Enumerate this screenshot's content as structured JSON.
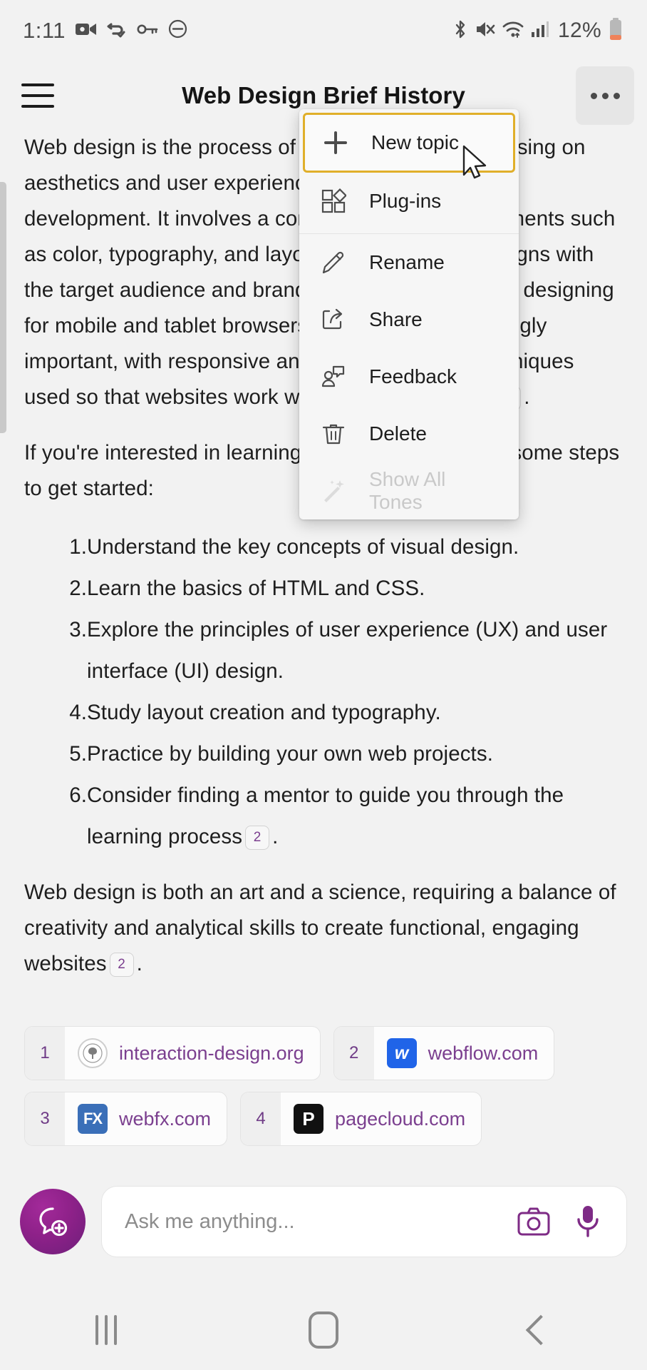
{
  "status_bar": {
    "time": "1:11",
    "battery_percent": "12%",
    "left_icons": [
      "camcorder-icon",
      "vpn-key-sync-icon",
      "key-icon",
      "dnd-icon"
    ],
    "right_icons": [
      "bluetooth-icon",
      "mute-icon",
      "wifi-icon",
      "cellular-signal-icon",
      "battery-icon"
    ],
    "battery_color": "#f0825a"
  },
  "app_bar": {
    "title": "Web Design Brief History",
    "menu_icon": "hamburger-icon",
    "overflow_icon": "more-options-icon"
  },
  "article": {
    "paragraph_1": "Web design is the process of creating websites, focusing on aesthetics and user experience rather than software development. It involves a combination of visual elements such as color, typography, and layout, ensuring the site aligns with the target audience and brand. Since the mid-2010s, designing for mobile and tablet browsers has become increasingly important, with responsive and adaptive design techniques used so that websites work well across all devices",
    "paragraph_1_cite": "1",
    "paragraph_2": "If you're interested in learning web design, here are some steps to get started:",
    "steps": [
      {
        "num": "1.",
        "text": "Understand the key concepts of visual design."
      },
      {
        "num": "2.",
        "text": "Learn the basics of HTML and CSS."
      },
      {
        "num": "3.",
        "text": "Explore the principles of user experience (UX) and user interface (UI) design."
      },
      {
        "num": "4.",
        "text": "Study layout creation and typography."
      },
      {
        "num": "5.",
        "text": "Practice by building your own web projects."
      },
      {
        "num": "6.",
        "text": "Consider finding a mentor to guide you through the learning process"
      }
    ],
    "steps_last_cite": "2",
    "paragraph_3": "Web design is both an art and a science, requiring a balance of creativity and analytical skills to create functional, engaging websites",
    "paragraph_3_cite": "2",
    "cite_color": "#7b3f8f"
  },
  "sources": [
    {
      "num": "1",
      "label": "interaction-design.org",
      "favicon": "tree-seal-icon",
      "favicon_text": ""
    },
    {
      "num": "2",
      "label": "webflow.com",
      "favicon": "webflow-icon",
      "favicon_text": "w"
    },
    {
      "num": "3",
      "label": "webfx.com",
      "favicon": "webfx-icon",
      "favicon_text": "FX"
    },
    {
      "num": "4",
      "label": "pagecloud.com",
      "favicon": "pagecloud-icon",
      "favicon_text": "P"
    }
  ],
  "overflow_menu": {
    "items": [
      {
        "label": "New topic",
        "icon": "plus-icon",
        "state": "focused"
      },
      {
        "label": "Plug-ins",
        "icon": "plugins-icon",
        "state": "normal"
      },
      {
        "label": "Rename",
        "icon": "pencil-icon",
        "state": "normal"
      },
      {
        "label": "Share",
        "icon": "share-icon",
        "state": "normal"
      },
      {
        "label": "Feedback",
        "icon": "feedback-icon",
        "state": "normal"
      },
      {
        "label": "Delete",
        "icon": "trash-icon",
        "state": "normal"
      },
      {
        "label": "Show All Tones",
        "icon": "magic-wand-icon",
        "state": "disabled"
      }
    ],
    "focus_color": "#e0af2a"
  },
  "composer": {
    "new_chat_icon": "new-chat-bubble-plus-icon",
    "input_value": "",
    "input_placeholder": "Ask me anything...",
    "camera_icon": "camera-icon",
    "mic_icon": "microphone-icon",
    "accent_color": "#7e2b86"
  },
  "nav_bar": {
    "recents_label": "recents-icon",
    "home_label": "home-icon",
    "back_label": "back-icon"
  }
}
